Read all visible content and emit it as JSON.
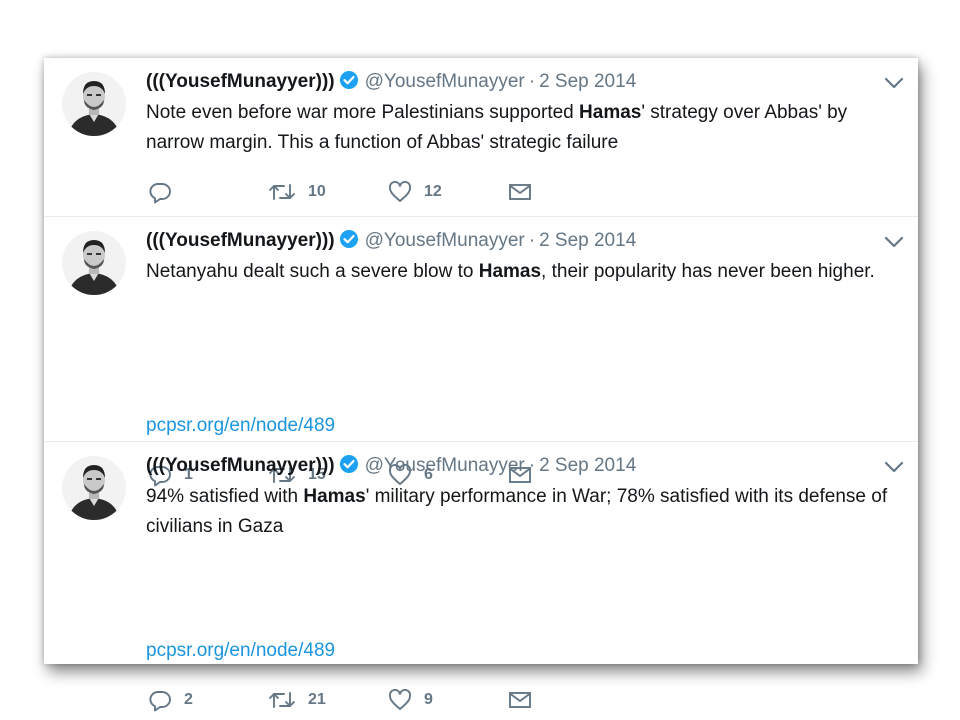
{
  "colors": {
    "link": "#1b95e0",
    "verified": "#1da1f2",
    "meta": "#657786",
    "text": "#14171a"
  },
  "tweets": [
    {
      "fullname": "(((YousefMunayyer)))",
      "screen_name": "@YousefMunayyer",
      "separator": "·",
      "date": "2 Sep 2014",
      "text_before": "Note even before war more Palestinians supported ",
      "text_bold": "Hamas",
      "text_after": "' strategy over Abbas' by narrow margin. This a function of Abbas' strategic failure",
      "link": "",
      "reply_count": "",
      "retweet_count": "10",
      "like_count": "12"
    },
    {
      "fullname": "(((YousefMunayyer)))",
      "screen_name": "@YousefMunayyer",
      "separator": "·",
      "date": "2 Sep 2014",
      "text_before": "Netanyahu dealt such a severe blow to ",
      "text_bold": "Hamas",
      "text_after": ", their popularity has never been higher.",
      "link": "pcpsr.org/en/node/489",
      "reply_count": "1",
      "retweet_count": "15",
      "like_count": "6"
    },
    {
      "fullname": "(((YousefMunayyer)))",
      "screen_name": "@YousefMunayyer",
      "separator": "·",
      "date": "2 Sep 2014",
      "text_before": "94% satisfied with ",
      "text_bold": "Hamas",
      "text_after": "' military performance in War; 78% satisfied with its defense of civilians in Gaza",
      "link": "pcpsr.org/en/node/489",
      "reply_count": "2",
      "retweet_count": "21",
      "like_count": "9"
    }
  ]
}
